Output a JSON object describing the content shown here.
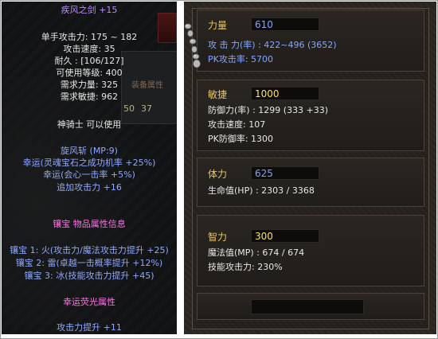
{
  "item_tooltip": {
    "name": "疾风之剑 +15",
    "base_stats": [
      "单手攻击力: 175 ~ 182",
      "攻击速度: 35",
      "耐久 : [106/127]",
      "可使用等级: 400",
      "需求力量: 325",
      "需求敏捷: 962"
    ],
    "class_req": "神骑士 可以使用",
    "skill_lines": [
      "旋风斩 (MP:9)",
      "幸运(灵魂宝石之成功机率 +25%)",
      "幸运(会心一击率 +5%)",
      "追加攻击力 +16"
    ],
    "socket_title": "镶宝 物品属性信息",
    "socket_lines": [
      "镶宝 1: 火(攻击力/魔法攻击力提升 +25)",
      "镶宝 2: 雷(卓越一击概率提升 +12%)",
      "镶宝 3: 冰(技能攻击力提升 +45)"
    ],
    "luck_title": "幸运荧光属性",
    "luck_line": "攻击力提升 +11",
    "background": {
      "label": "装备属性",
      "nums": [
        "50",
        "37"
      ]
    }
  },
  "character_stats": {
    "strength": {
      "label": "力量",
      "value": "610",
      "lines": [
        "攻 击 力(率) : 422~496 (3652)",
        "PK攻击率: 5700"
      ]
    },
    "agility": {
      "label": "敏捷",
      "value": "1000",
      "lines": [
        "防御力(率) : 1299 (333 +33)",
        "攻击速度: 107",
        "PK防御率: 1300"
      ]
    },
    "vitality": {
      "label": "体力",
      "value": "625",
      "lines": [
        "生命值(HP) : 2303 / 3368"
      ]
    },
    "energy": {
      "label": "智力",
      "value": "300",
      "lines": [
        "魔法值(MP) : 674 / 674",
        "技能攻击力: 230%"
      ]
    }
  }
}
